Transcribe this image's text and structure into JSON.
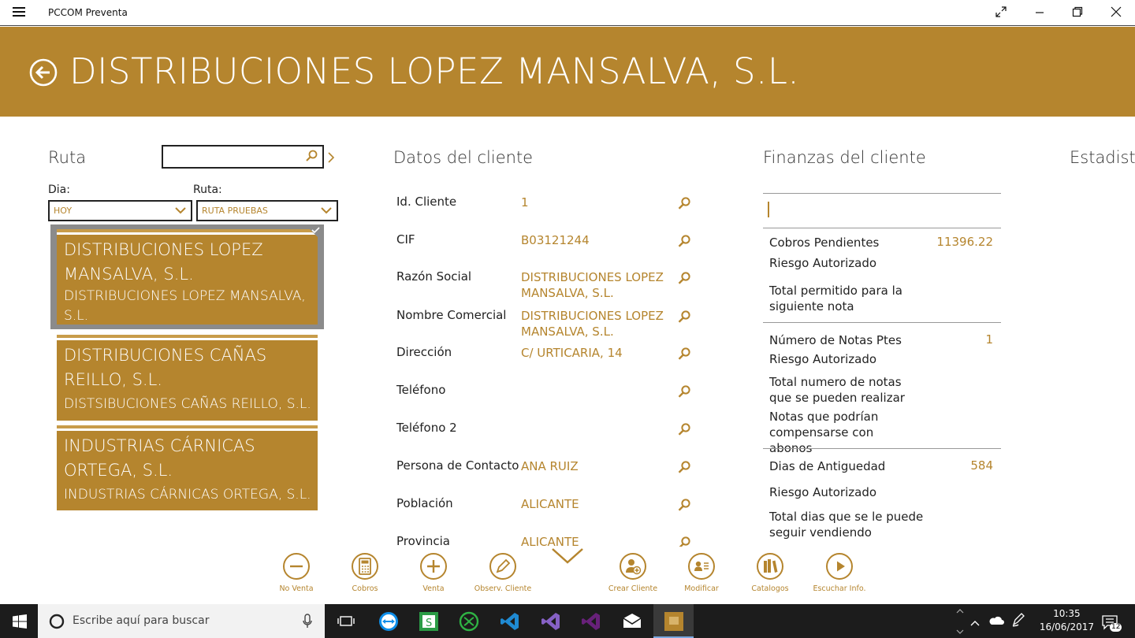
{
  "window": {
    "title": "PCCOM Preventa"
  },
  "header": {
    "client_name": "DISTRIBUCIONES LOPEZ MANSALVA, S.L."
  },
  "ruta": {
    "heading": "Ruta",
    "search_value": "",
    "dia_label": "Dia:",
    "dia_value": "HOY",
    "ruta_label": "Ruta:",
    "ruta_value": "RUTA PRUEBAS",
    "clients": [
      {
        "title": "DISTRIBUCIONES LOPEZ MANSALVA, S.L.",
        "subtitle": "DISTRIBUCIONES LOPEZ MANSALVA, S.L.",
        "selected": true
      },
      {
        "title": "DISTRIBUCIONES CAÑAS REILLO, S.L.",
        "subtitle": "DISTSIBUCIONES CAÑAS REILLO, S.L.",
        "selected": false
      },
      {
        "title": "INDUSTRIAS CÁRNICAS ORTEGA, S.L.",
        "subtitle": "INDUSTRIAS CÁRNICAS ORTEGA, S.L.",
        "selected": false
      }
    ]
  },
  "datos": {
    "heading": "Datos del cliente",
    "fields": [
      {
        "label": "Id. Cliente",
        "value": "1"
      },
      {
        "label": "CIF",
        "value": "B03121244"
      },
      {
        "label": "Razón Social",
        "value": "DISTRIBUCIONES LOPEZ MANSALVA, S.L."
      },
      {
        "label": "Nombre Comercial",
        "value": "DISTRIBUCIONES LOPEZ MANSALVA, S.L."
      },
      {
        "label": "Dirección",
        "value": "C/ URTICARIA, 14"
      },
      {
        "label": "Teléfono",
        "value": ""
      },
      {
        "label": "Teléfono 2",
        "value": ""
      },
      {
        "label": "Persona de Contacto",
        "value": "ANA RUIZ"
      },
      {
        "label": "Población",
        "value": "ALICANTE"
      },
      {
        "label": "Provincia",
        "value": "ALICANTE"
      }
    ]
  },
  "finanzas": {
    "heading": "Finanzas del cliente",
    "cobros_pendientes_label": "Cobros Pendientes",
    "cobros_pendientes_value": "11396.22",
    "riesgo1": "Riesgo Autorizado",
    "total_permitido": "Total permitido para la siguiente nota",
    "num_notas_label": "Número de Notas Ptes",
    "num_notas_value": "1",
    "riesgo2": "Riesgo Autorizado",
    "total_notas": "Total numero de notas que se pueden realizar",
    "notas_compensar": "Notas que podrían compensarse con abonos",
    "dias_label": "Dias de Antiguedad",
    "dias_value": "584",
    "riesgo3": "Riesgo Autorizado",
    "total_dias": "Total dias que se le puede seguir vendiendo"
  },
  "estadisticas": {
    "heading": "Estadisti"
  },
  "appbar": {
    "buttons": [
      {
        "label": "No Venta",
        "icon": "minus-icon"
      },
      {
        "label": "Cobros",
        "icon": "calculator-icon"
      },
      {
        "label": "Venta",
        "icon": "plus-icon"
      },
      {
        "label": "Observ. Cliente",
        "icon": "pencil-icon"
      },
      {
        "label": "Crear Cliente",
        "icon": "add-user-icon"
      },
      {
        "label": "Modificar",
        "icon": "contact-card-icon"
      },
      {
        "label": "Catalogos",
        "icon": "library-icon"
      },
      {
        "label": "Escuchar Info.",
        "icon": "play-icon"
      }
    ]
  },
  "taskbar": {
    "search_placeholder": "Escribe aquí para buscar",
    "time": "10:35",
    "date": "16/06/2017",
    "notifications": "12"
  },
  "colors": {
    "accent": "#b5852e",
    "header": "#b5852e"
  }
}
